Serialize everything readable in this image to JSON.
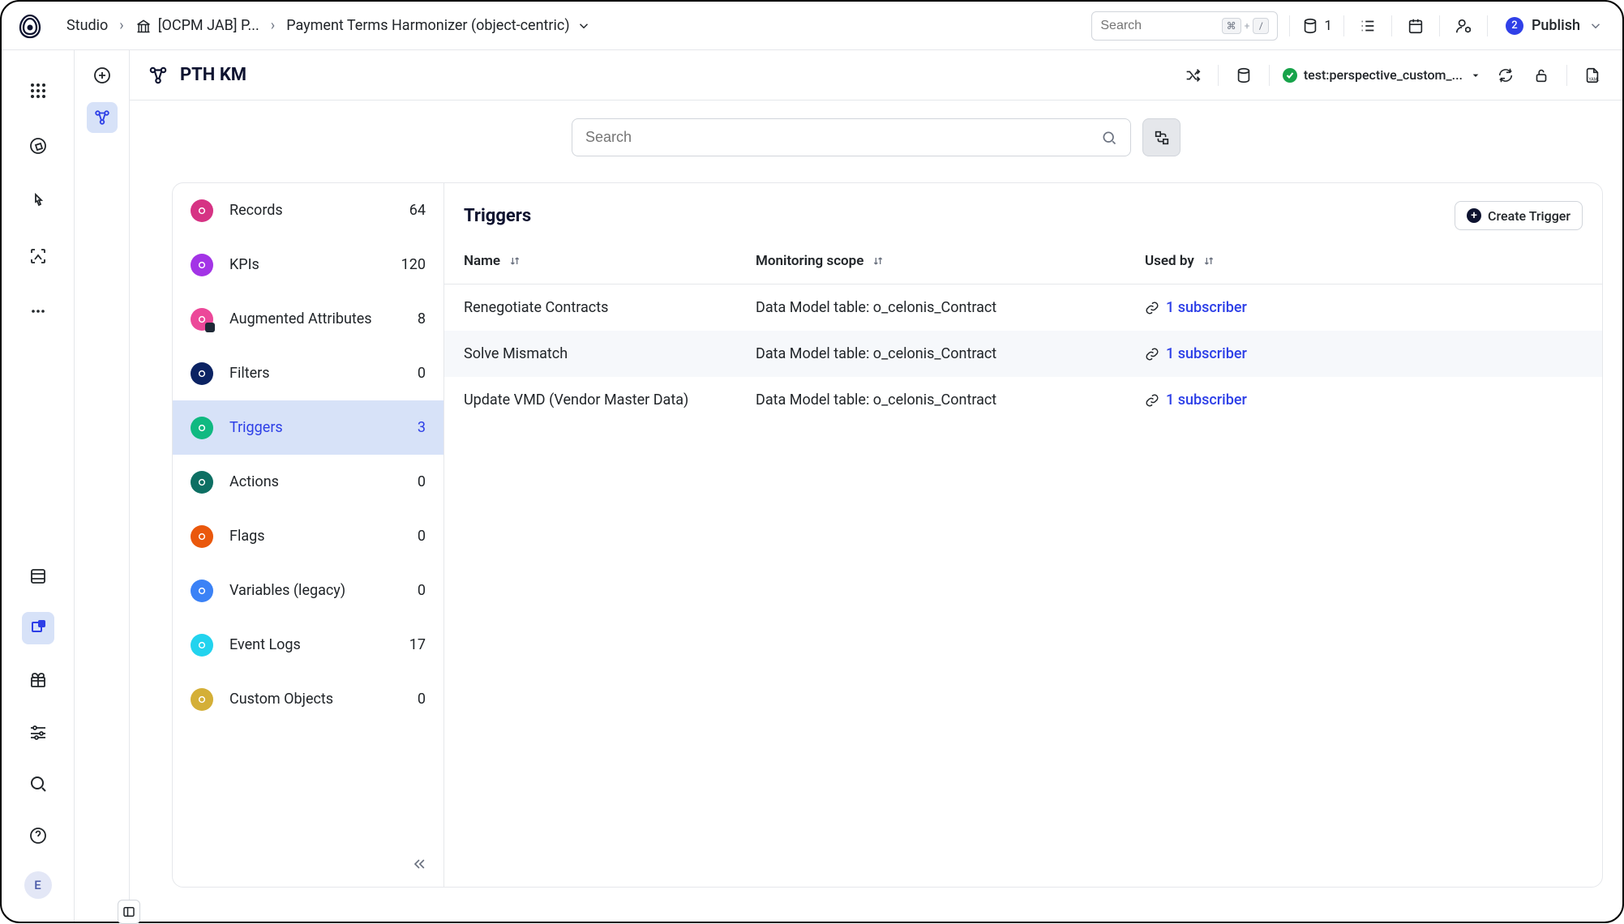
{
  "breadcrumb": {
    "root": "Studio",
    "package": "[OCPM JAB] P...",
    "view": "Payment Terms Harmonizer (object-centric)"
  },
  "topbar": {
    "search_placeholder": "Search",
    "kbd1": "⌘",
    "kbd_plus": "+",
    "kbd2": "/",
    "pill_count": "1",
    "publish_label": "Publish",
    "publish_badge": "2"
  },
  "subheader": {
    "title": "PTH KM",
    "perspective": "test:perspective_custom_..."
  },
  "mainSearch": {
    "placeholder": "Search"
  },
  "categories": [
    {
      "label": "Records",
      "count": "64",
      "iconClass": "ci-records"
    },
    {
      "label": "KPIs",
      "count": "120",
      "iconClass": "ci-kpis"
    },
    {
      "label": "Augmented Attributes",
      "count": "8",
      "iconClass": "ci-aug"
    },
    {
      "label": "Filters",
      "count": "0",
      "iconClass": "ci-filters"
    },
    {
      "label": "Triggers",
      "count": "3",
      "iconClass": "ci-triggers",
      "selected": true
    },
    {
      "label": "Actions",
      "count": "0",
      "iconClass": "ci-actions"
    },
    {
      "label": "Flags",
      "count": "0",
      "iconClass": "ci-flags"
    },
    {
      "label": "Variables (legacy)",
      "count": "0",
      "iconClass": "ci-variables"
    },
    {
      "label": "Event Logs",
      "count": "17",
      "iconClass": "ci-eventlogs"
    },
    {
      "label": "Custom Objects",
      "count": "0",
      "iconClass": "ci-custom"
    }
  ],
  "detail": {
    "title": "Triggers",
    "create_label": "Create Trigger",
    "columns": {
      "name": "Name",
      "scope": "Monitoring scope",
      "usedby": "Used by"
    },
    "rows": [
      {
        "name": "Renegotiate Contracts",
        "scope": "Data Model table: o_celonis_Contract",
        "usedby": "1 subscriber"
      },
      {
        "name": "Solve Mismatch",
        "scope": "Data Model table: o_celonis_Contract",
        "usedby": "1 subscriber",
        "hover": true
      },
      {
        "name": "Update VMD (Vendor Master Data)",
        "scope": "Data Model table: o_celonis_Contract",
        "usedby": "1 subscriber"
      }
    ]
  },
  "avatar": "E"
}
